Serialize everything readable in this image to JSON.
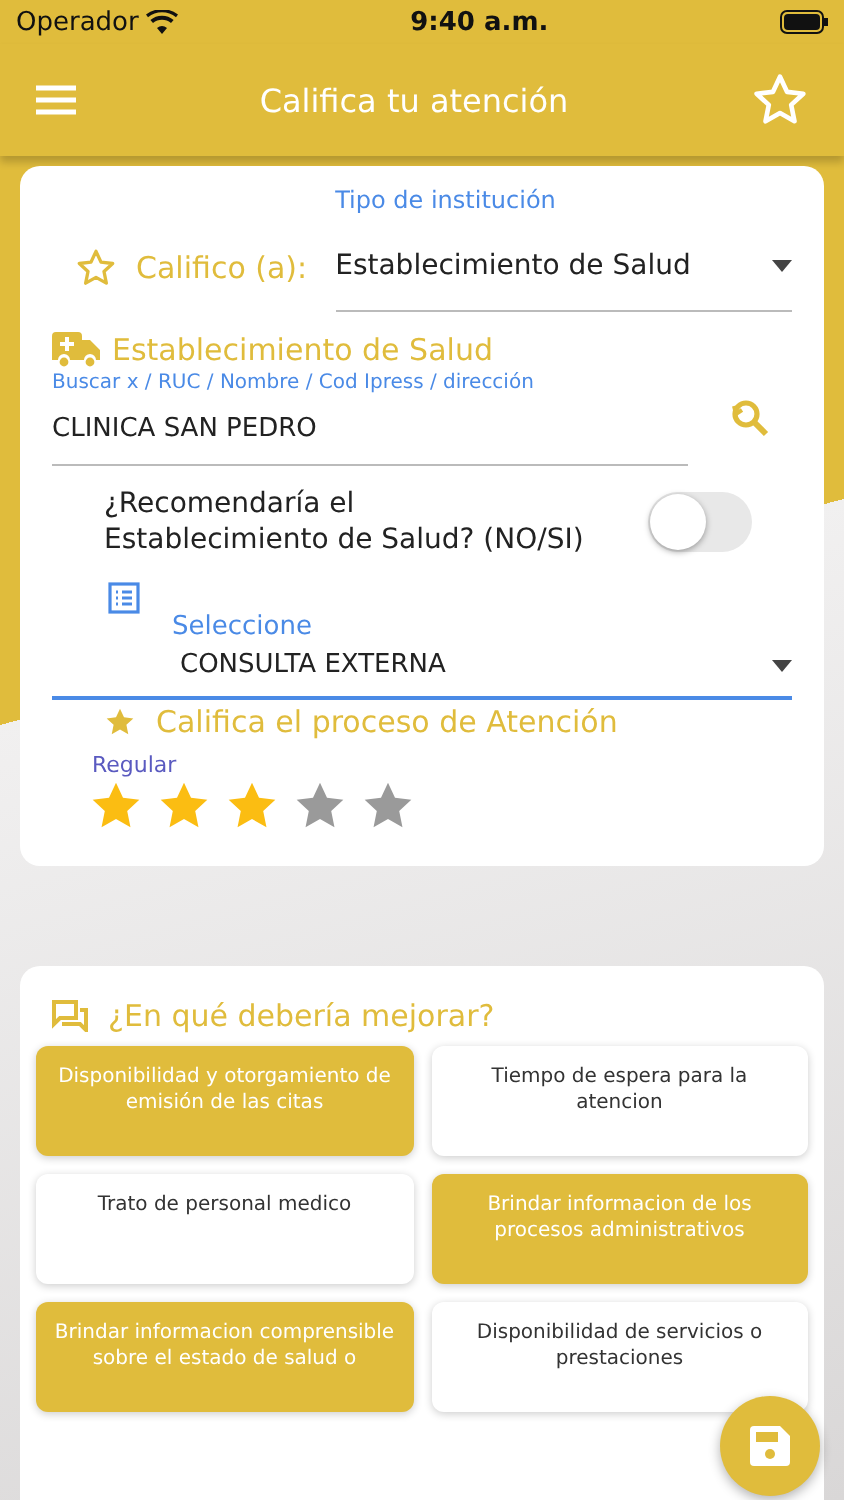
{
  "status_bar": {
    "carrier": "Operador",
    "time": "9:40 a.m."
  },
  "header": {
    "title": "Califica tu atención"
  },
  "form": {
    "califico_label": "Califico (a):",
    "tipo_label": "Tipo de institución",
    "tipo_value": "Establecimiento de Salud",
    "section_title": "Establecimiento de Salud",
    "search_label": "Buscar x / RUC / Nombre / Cod Ipress / dirección",
    "search_value": "CLINICA SAN PEDRO",
    "recommend": {
      "question": "¿Recomendaría el Establecimiento de Salud? (NO/SI)",
      "on": false
    },
    "select_label": "Seleccione",
    "select_value": "CONSULTA EXTERNA",
    "rating": {
      "title": "Califica el proceso de Atención",
      "label": "Regular",
      "stars": 3
    }
  },
  "improve": {
    "title": "¿En qué debería mejorar?",
    "options": [
      {
        "label": "Disponibilidad y otorgamiento de emisión de las citas",
        "selected": true
      },
      {
        "label": "Tiempo de espera para la atencion",
        "selected": false
      },
      {
        "label": "Trato de personal medico",
        "selected": false
      },
      {
        "label": "Brindar informacion de los procesos administrativos",
        "selected": true
      },
      {
        "label": "Brindar informacion comprensible sobre el estado de salud o",
        "selected": true
      },
      {
        "label": "Disponibilidad de servicios o prestaciones",
        "selected": false
      }
    ]
  }
}
